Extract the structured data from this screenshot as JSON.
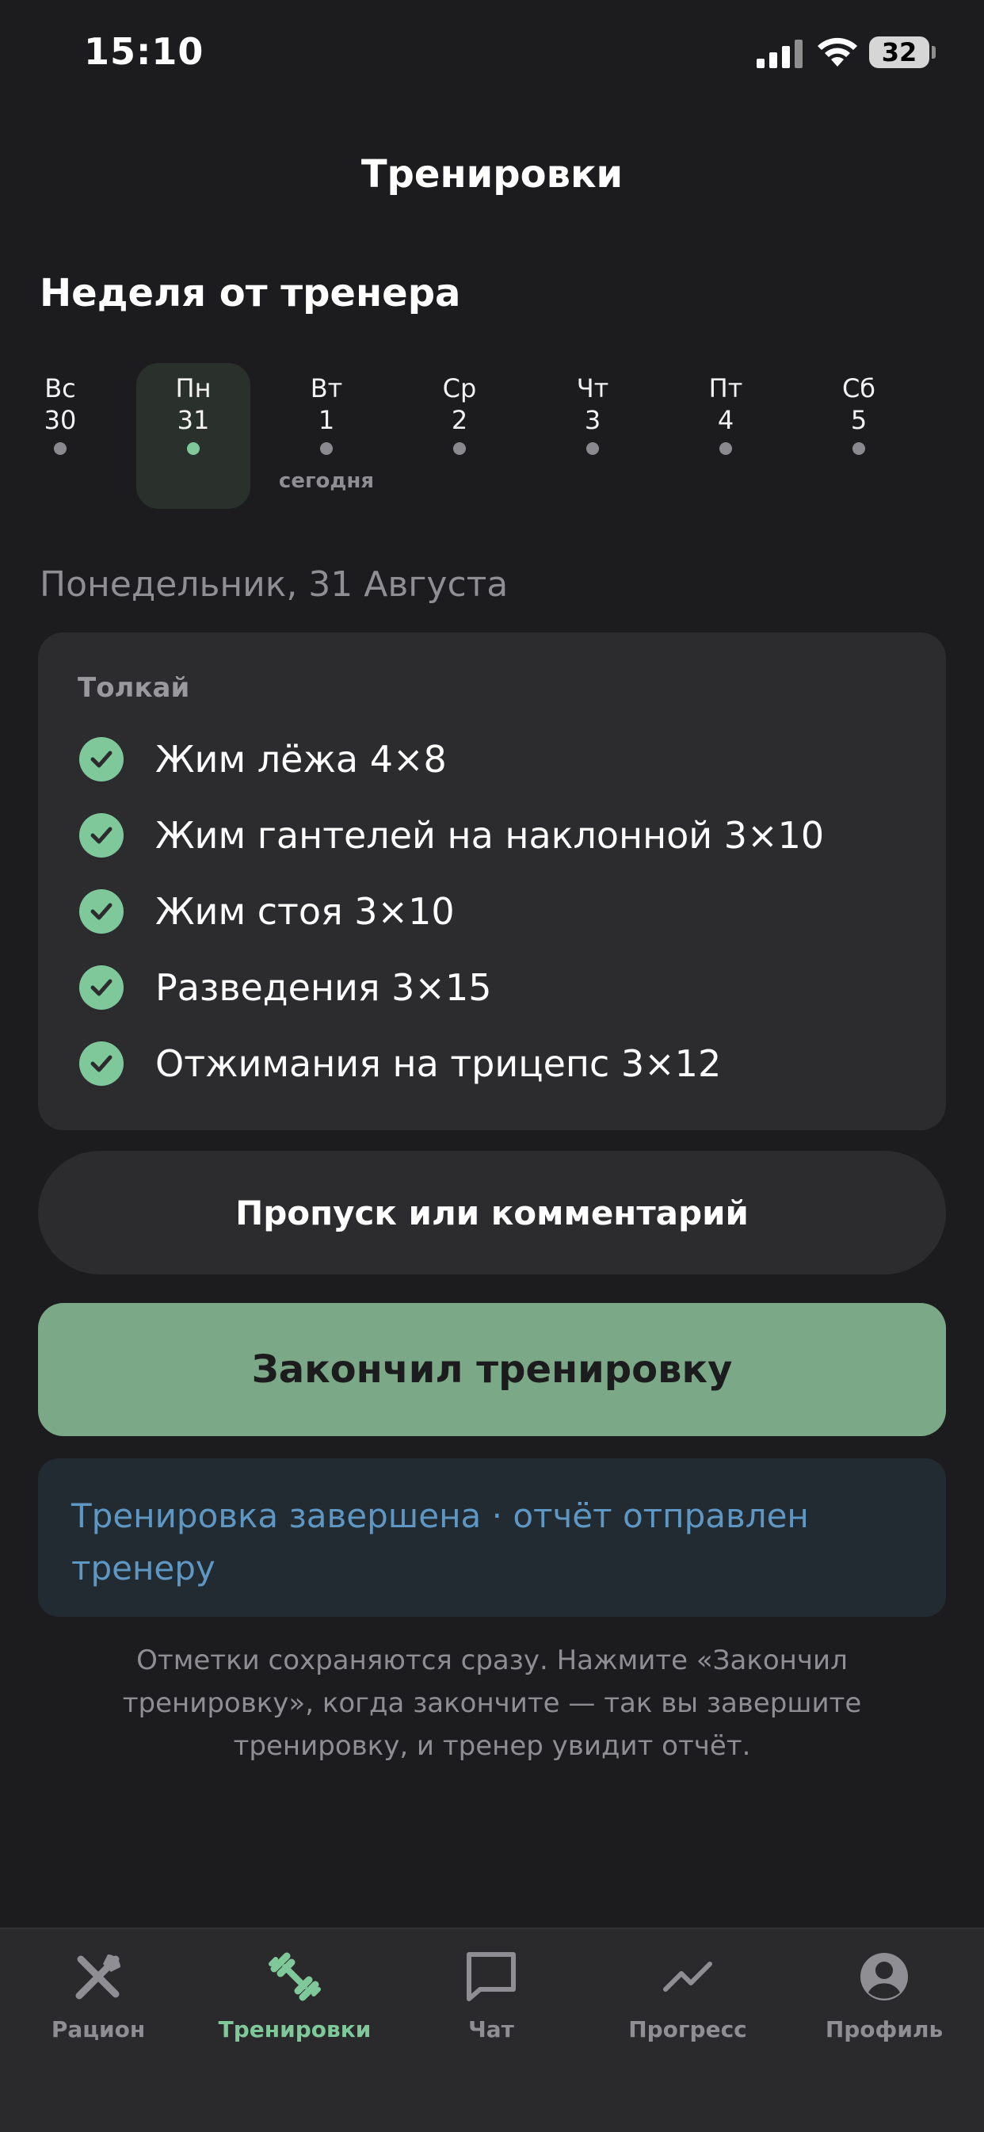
{
  "status_bar": {
    "time": "15:10",
    "battery": "32"
  },
  "header": {
    "title": "Тренировки"
  },
  "week": {
    "title": "Неделя от тренера",
    "days": [
      {
        "name": "Вс",
        "num": "30"
      },
      {
        "name": "Пн",
        "num": "31"
      },
      {
        "name": "Вт",
        "num": "1"
      },
      {
        "name": "Ср",
        "num": "2"
      },
      {
        "name": "Чт",
        "num": "3"
      },
      {
        "name": "Пт",
        "num": "4"
      },
      {
        "name": "Сб",
        "num": "5"
      }
    ],
    "selected_index": 1,
    "today_label": "сегодня"
  },
  "date_label": "Понедельник, 31 Августа",
  "workout": {
    "title": "Толкай",
    "exercises": [
      {
        "label": "Жим лёжа 4×8",
        "done": true
      },
      {
        "label": "Жим гантелей на наклонной 3×10",
        "done": true
      },
      {
        "label": "Жим стоя 3×10",
        "done": true
      },
      {
        "label": "Разведения 3×15",
        "done": true
      },
      {
        "label": "Отжимания на трицепс 3×12",
        "done": true
      }
    ]
  },
  "buttons": {
    "skip": "Пропуск или комментарий",
    "finish": "Закончил тренировку"
  },
  "notice": "Тренировка завершена · отчёт отправлен тренеру",
  "hint": "Отметки сохраняются сразу. Нажмите «Закончил тренировку», когда закончите — так вы завершите тренировку, и тренер увидит отчёт.",
  "tabs": [
    {
      "label": "Рацион",
      "icon": "fork-knife-icon"
    },
    {
      "label": "Тренировки",
      "icon": "dumbbell-icon"
    },
    {
      "label": "Чат",
      "icon": "chat-icon"
    },
    {
      "label": "Прогресс",
      "icon": "trend-icon"
    },
    {
      "label": "Профиль",
      "icon": "profile-icon"
    }
  ],
  "active_tab": 1,
  "colors": {
    "accent": "#7fc89a",
    "finish_button": "#7ba886",
    "notice_text": "#5e97c4",
    "background": "#1c1c1e",
    "card": "#2c2c2e"
  }
}
